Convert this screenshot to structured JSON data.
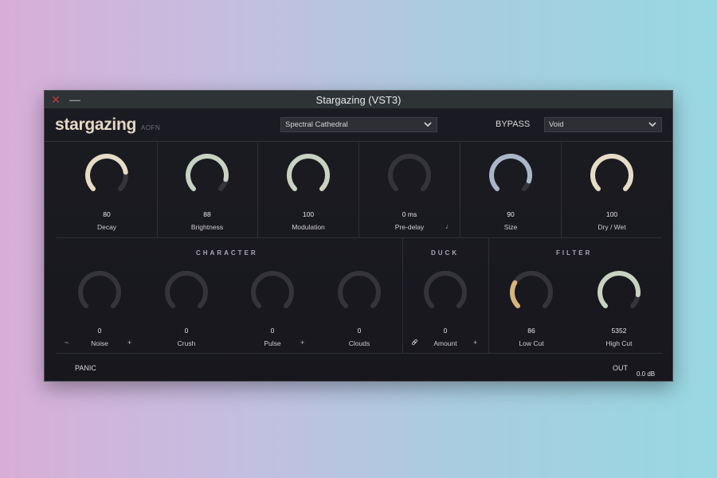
{
  "window": {
    "title": "Stargazing (VST3)"
  },
  "header": {
    "logo": "stargazing",
    "logo_sub": "AOFN",
    "preset": "Spectral Cathedral",
    "bypass": "BYPASS",
    "mode": "Void"
  },
  "colors": {
    "cream": "#e6dcc6",
    "sage": "#c7d2c0",
    "gray": "#58585e",
    "blue_gray": "#aab6c8",
    "gold": "#d8b27c",
    "track": "#34343a"
  },
  "top_knobs": [
    {
      "label": "Decay",
      "value": "80",
      "level": 0.8
    },
    {
      "label": "Brightness",
      "value": "88",
      "level": 0.88
    },
    {
      "label": "Modulation",
      "value": "100",
      "level": 1.0
    },
    {
      "label": "Pre-delay",
      "value": "0 ms",
      "level": 0.0,
      "icon": "note-icon"
    },
    {
      "label": "Size",
      "value": "90",
      "level": 0.9
    },
    {
      "label": "Dry / Wet",
      "value": "100",
      "level": 1.0
    }
  ],
  "character": {
    "title": "CHARACTER",
    "knobs": [
      {
        "label": "Noise",
        "value": "0",
        "level": 0.0,
        "icon_left": "~",
        "icon_right": "+"
      },
      {
        "label": "Crush",
        "value": "0",
        "level": 0.0
      },
      {
        "label": "Pulse",
        "value": "0",
        "level": 0.0,
        "icon_right": "+"
      },
      {
        "label": "Clouds",
        "value": "0",
        "level": 0.0
      }
    ]
  },
  "duck": {
    "title": "DUCK",
    "knobs": [
      {
        "label": "Amount",
        "value": "0",
        "level": 0.0,
        "icon_left": "link",
        "icon_right": "+"
      }
    ]
  },
  "filter": {
    "title": "FILTER",
    "knobs": [
      {
        "label": "Low Cut",
        "value": "86",
        "level": 0.28
      },
      {
        "label": "High Cut",
        "value": "5352",
        "level": 0.86
      }
    ]
  },
  "footer": {
    "panic": "PANIC",
    "out_label": "OUT",
    "out_value": "0.0 dB"
  }
}
